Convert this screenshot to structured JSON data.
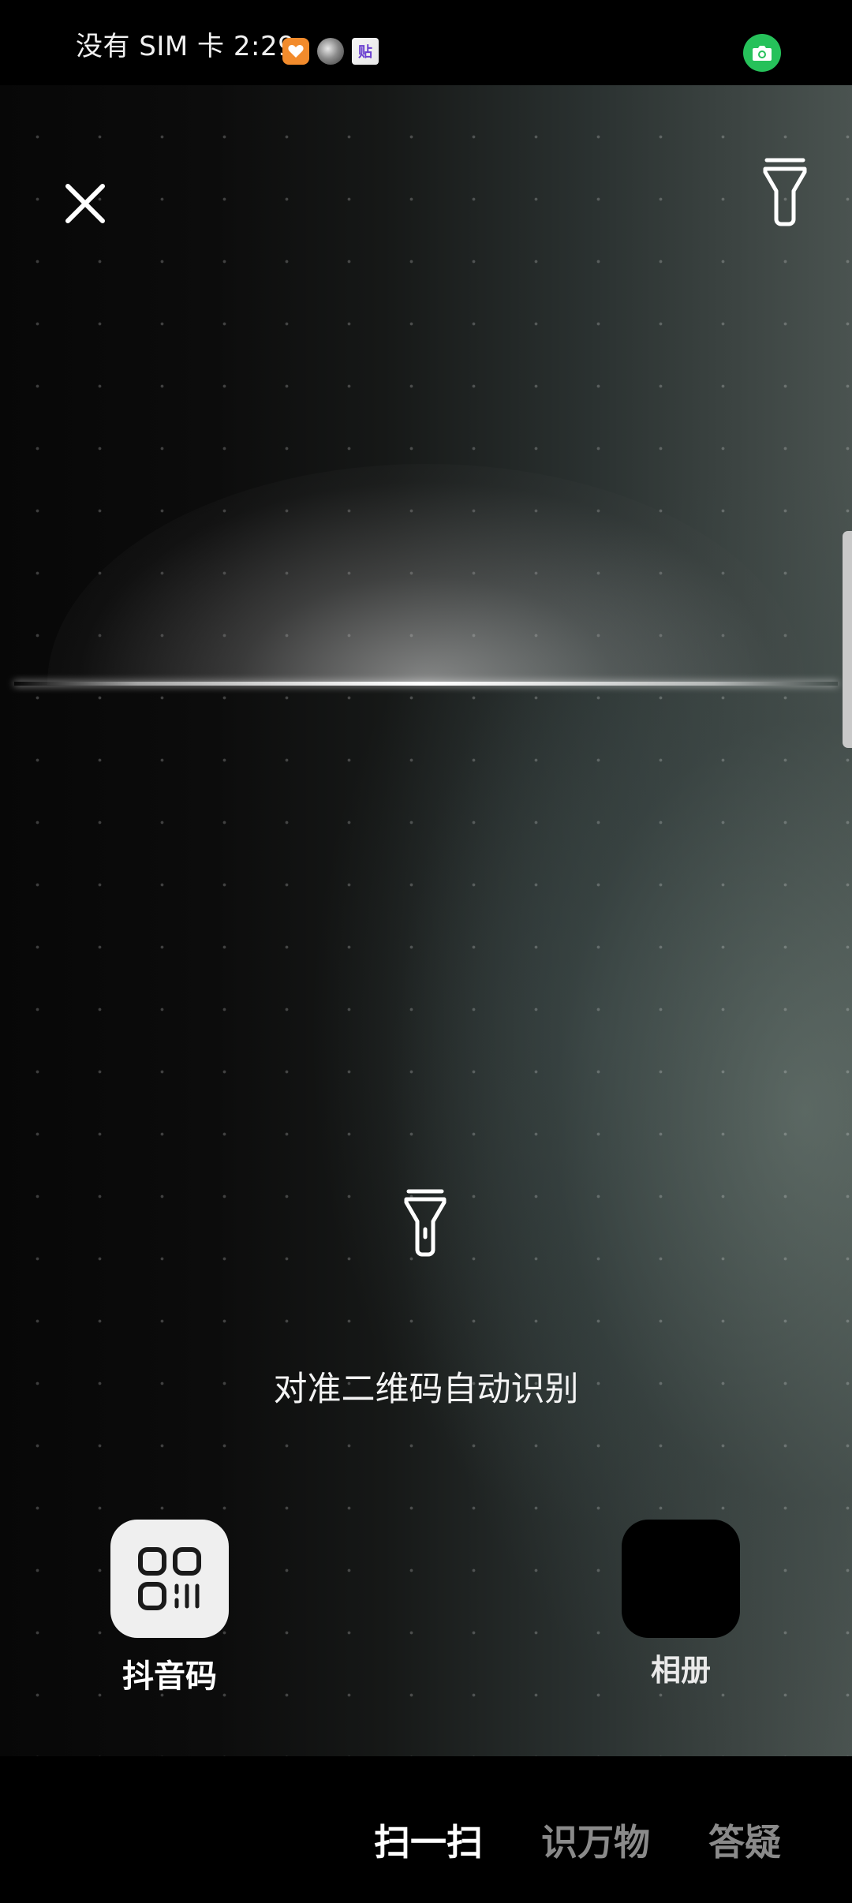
{
  "status_bar": {
    "text": "没有 SIM 卡 2:29",
    "icons": [
      "heart-badge-icon",
      "ball-app-icon",
      "tile-app-icon"
    ],
    "tile_icon_glyph": "贴",
    "camera_indicator": "camera-in-use-icon",
    "camera_indicator_color": "#26c15a"
  },
  "toolbar": {
    "close_icon": "close-icon",
    "flashlight_icon": "flashlight-icon"
  },
  "scanner": {
    "hint": "对准二维码自动识别",
    "flashlight_icon": "flashlight-icon"
  },
  "shortcuts": {
    "qr": {
      "label": "抖音码",
      "icon": "qr-code-icon"
    },
    "album": {
      "label": "相册",
      "icon": "album-thumbnail"
    }
  },
  "modes": {
    "scan": "扫一扫",
    "object": "识万物",
    "qa": "答疑",
    "active": "扫一扫"
  }
}
